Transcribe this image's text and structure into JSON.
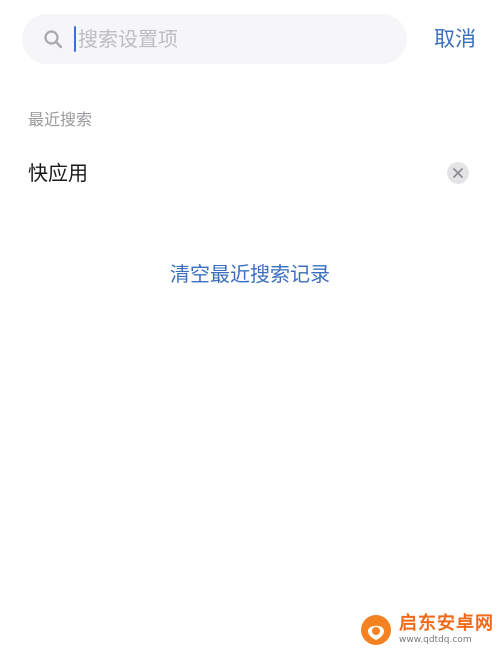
{
  "search": {
    "placeholder": "搜索设置项",
    "value": "",
    "cancel_label": "取消"
  },
  "recent": {
    "title": "最近搜索",
    "items": [
      {
        "label": "快应用"
      }
    ],
    "clear_label": "清空最近搜索记录"
  },
  "watermark": {
    "name": "启东安卓网",
    "url": "www.qdtdq.com"
  },
  "colors": {
    "accent": "#3a6fbf",
    "caret": "#3d6fd8",
    "secondary_text": "#9a9a9e",
    "search_bg": "#f6f6f8",
    "watermark": "#f06a1a"
  },
  "icons": {
    "search": "search-icon",
    "remove": "close-icon",
    "logo": "logo-icon"
  }
}
